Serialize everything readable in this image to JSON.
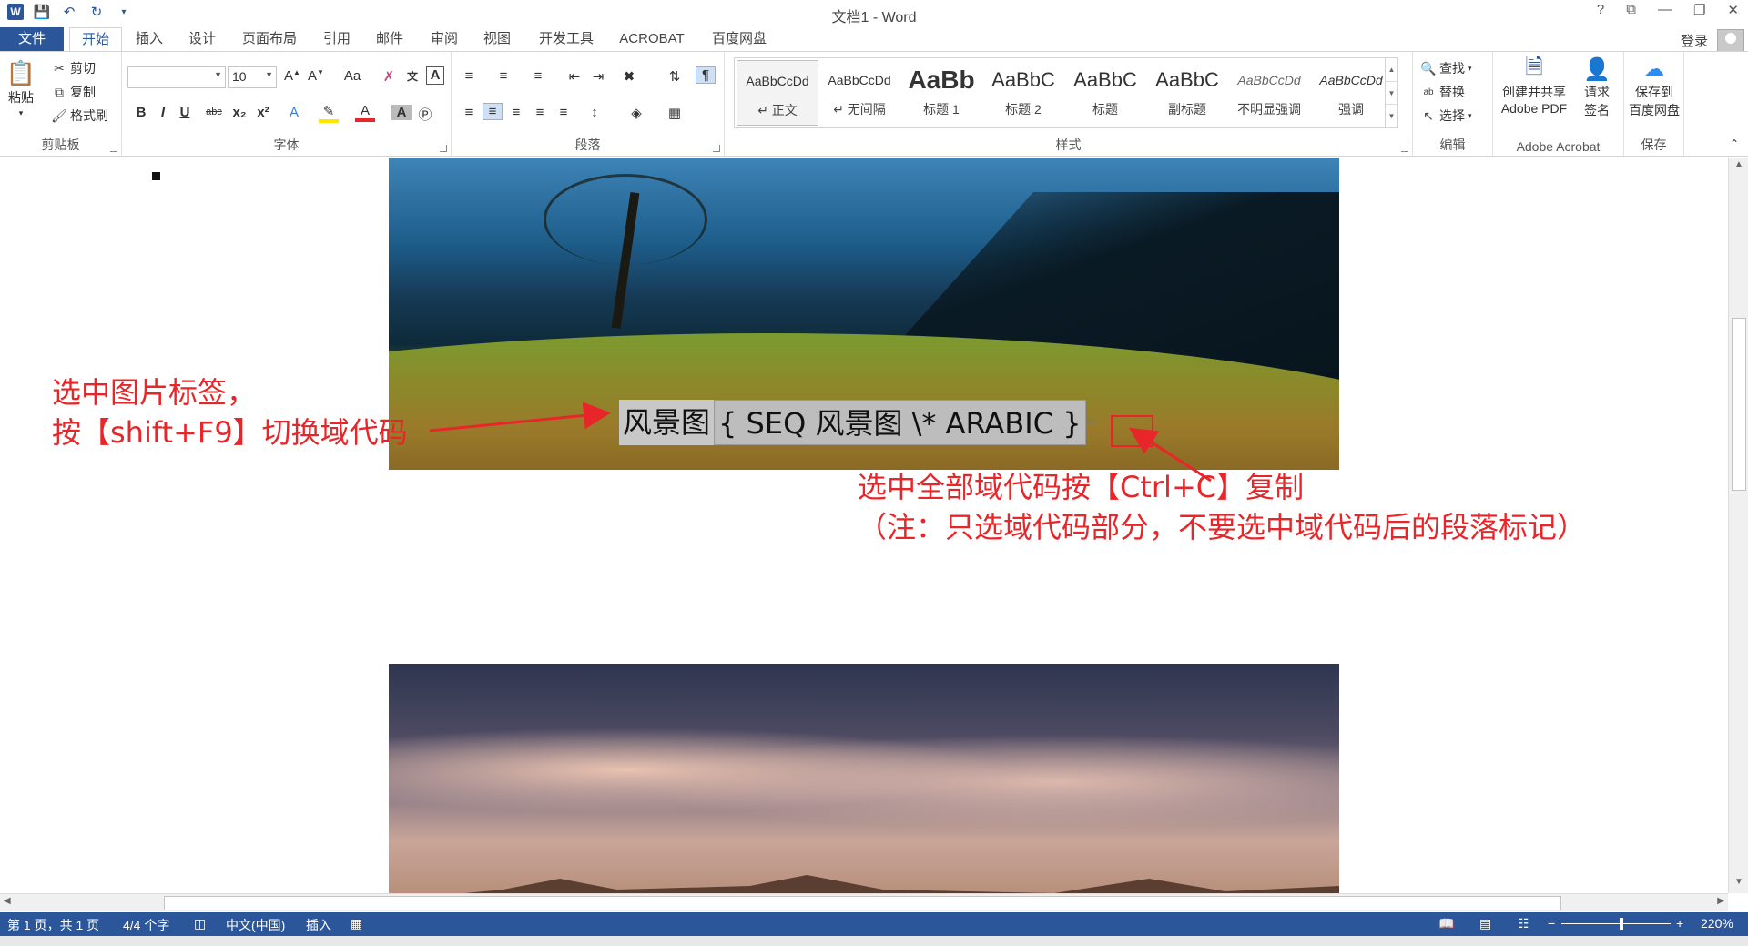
{
  "window": {
    "title": "文档1 - Word",
    "controls": [
      "?",
      "⧉",
      "—",
      "❐",
      "✕"
    ]
  },
  "qat": {
    "icons": [
      "word-logo-icon",
      "save-icon",
      "undo-icon",
      "redo-icon",
      "customize-icon"
    ],
    "logo_letter": "W"
  },
  "tabs": {
    "file": "文件",
    "items": [
      "开始",
      "插入",
      "设计",
      "页面布局",
      "引用",
      "邮件",
      "审阅",
      "视图",
      "开发工具",
      "ACROBAT",
      "百度网盘"
    ],
    "active": "开始",
    "login": "登录"
  },
  "ribbon": {
    "clipboard": {
      "paste": "粘贴",
      "cut": "剪切",
      "copy": "复制",
      "format_painter": "格式刷",
      "label": "剪贴板"
    },
    "font": {
      "font_name": "",
      "font_size": "10",
      "label": "字体",
      "bold": "B",
      "italic": "I",
      "underline": "U",
      "strike": "abc",
      "sub": "x₂",
      "sup": "x²",
      "case": "Aa"
    },
    "paragraph": {
      "label": "段落"
    },
    "styles": {
      "label": "样式",
      "items": [
        {
          "sample": "AaBbCcDd",
          "name": "↵ 正文"
        },
        {
          "sample": "AaBbCcDd",
          "name": "↵ 无间隔"
        },
        {
          "sample": "AaBb",
          "name": "标题 1"
        },
        {
          "sample": "AaBbC",
          "name": "标题 2"
        },
        {
          "sample": "AaBbC",
          "name": "标题"
        },
        {
          "sample": "AaBbC",
          "name": "副标题"
        },
        {
          "sample": "AaBbCcDd",
          "name": "不明显强调"
        },
        {
          "sample": "AaBbCcDd",
          "name": "强调"
        }
      ]
    },
    "editing": {
      "find": "查找",
      "replace": "替换",
      "select": "选择",
      "label": "编辑"
    },
    "acrobat": {
      "create_share_line1": "创建并共享",
      "create_share_line2": "Adobe PDF",
      "request_line1": "请求",
      "request_line2": "签名",
      "label": "Adobe Acrobat"
    },
    "save": {
      "line1": "保存到",
      "line2": "百度网盘",
      "label": "保存"
    }
  },
  "document": {
    "caption_text": "风景图",
    "field_code": "{ SEQ 风景图 \\* ARABIC }",
    "para_mark": "↵",
    "annotation1_line1": "选中图片标签，",
    "annotation1_line2": "按【shift+F9】切换域代码",
    "annotation2_line1": "选中全部域代码按【Ctrl+C】复制",
    "annotation2_line2": "（注：只选域代码部分，不要选中域代码后的段落标记）"
  },
  "statusbar": {
    "page": "第 1 页，共 1 页",
    "words": "4/4 个字",
    "language": "中文(中国)",
    "mode": "插入",
    "zoom": "220%",
    "zoom_fraction": 0.55
  },
  "colors": {
    "accent": "#2b579a",
    "annotation": "#e8262a",
    "selection": "#c8c8c8"
  }
}
